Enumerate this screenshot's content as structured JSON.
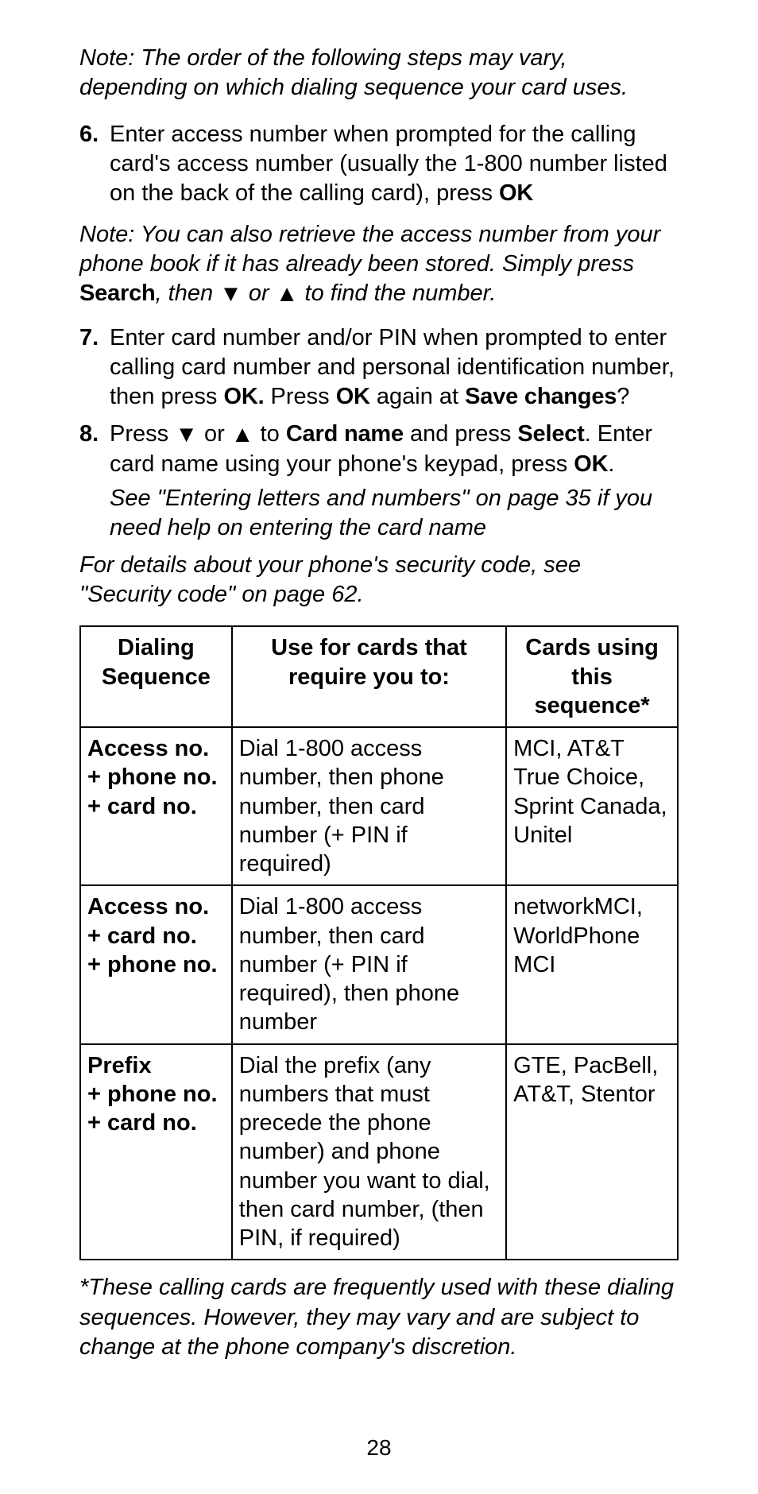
{
  "note_top": "Note: The order of the following steps may vary, depending on which dialing sequence your card uses.",
  "step6_num": "6.",
  "step6_a": "Enter access number when prompted for the calling card's access number (usually the 1-800 number listed on the back of the calling card), press ",
  "step6_ok": "OK",
  "note_mid_a": "Note: You can also retrieve the access number from your phone book if it has already been stored. Simply press ",
  "note_mid_search": "Search",
  "note_mid_b": ", then ",
  "note_mid_down": "▼",
  "note_mid_c": " or ",
  "note_mid_up": "▲",
  "note_mid_d": " to find the number.",
  "step7_num": "7.",
  "step7_a": "Enter card number and/or PIN when prompted to enter calling card number and personal identification number, then press ",
  "step7_ok1": "OK.",
  "step7_b": " Press ",
  "step7_ok2": "OK",
  "step7_c": " again at ",
  "step7_save": "Save changes",
  "step7_q": "?",
  "step8_num": "8.",
  "step8_a": "Press ",
  "step8_down": "▼",
  "step8_b": " or ",
  "step8_up": "▲",
  "step8_c": " to ",
  "step8_cardname": "Card name",
  "step8_d": " and press ",
  "step8_select": "Select",
  "step8_e": ". Enter card name using your phone's keypad, press ",
  "step8_ok": "OK",
  "step8_f": ".",
  "step8_note": "See \"Entering letters and numbers\" on page 35 if you need help on entering the card name",
  "details": "For details about your phone's security code, see \"Security code\" on page 62.",
  "th1": "Dialing Sequence",
  "th2": "Use for cards that require you to:",
  "th3": "Cards using this sequence*",
  "r1c1": "Access no.\n+ phone no.\n+ card no.",
  "r1c2": "Dial 1-800 access number, then phone number, then card number (+ PIN if required)",
  "r1c3": "MCI, AT&T True Choice, Sprint Canada, Unitel",
  "r2c1": "Access no.\n+ card no.\n+ phone no.",
  "r2c2": "Dial 1-800 access number, then card number (+ PIN if required), then phone number",
  "r2c3": "networkMCI, WorldPhone MCI",
  "r3c1": "Prefix\n+ phone no.\n+ card no.",
  "r3c2": "Dial the prefix (any numbers that must precede the phone number) and phone number you want to dial, then card number, (then PIN, if required)",
  "r3c3": "GTE, PacBell, AT&T, Stentor",
  "footnote": "*These calling cards are frequently used with these dialing sequences. However, they may vary and are subject to change at the phone company's discretion.",
  "pagenum": "28"
}
